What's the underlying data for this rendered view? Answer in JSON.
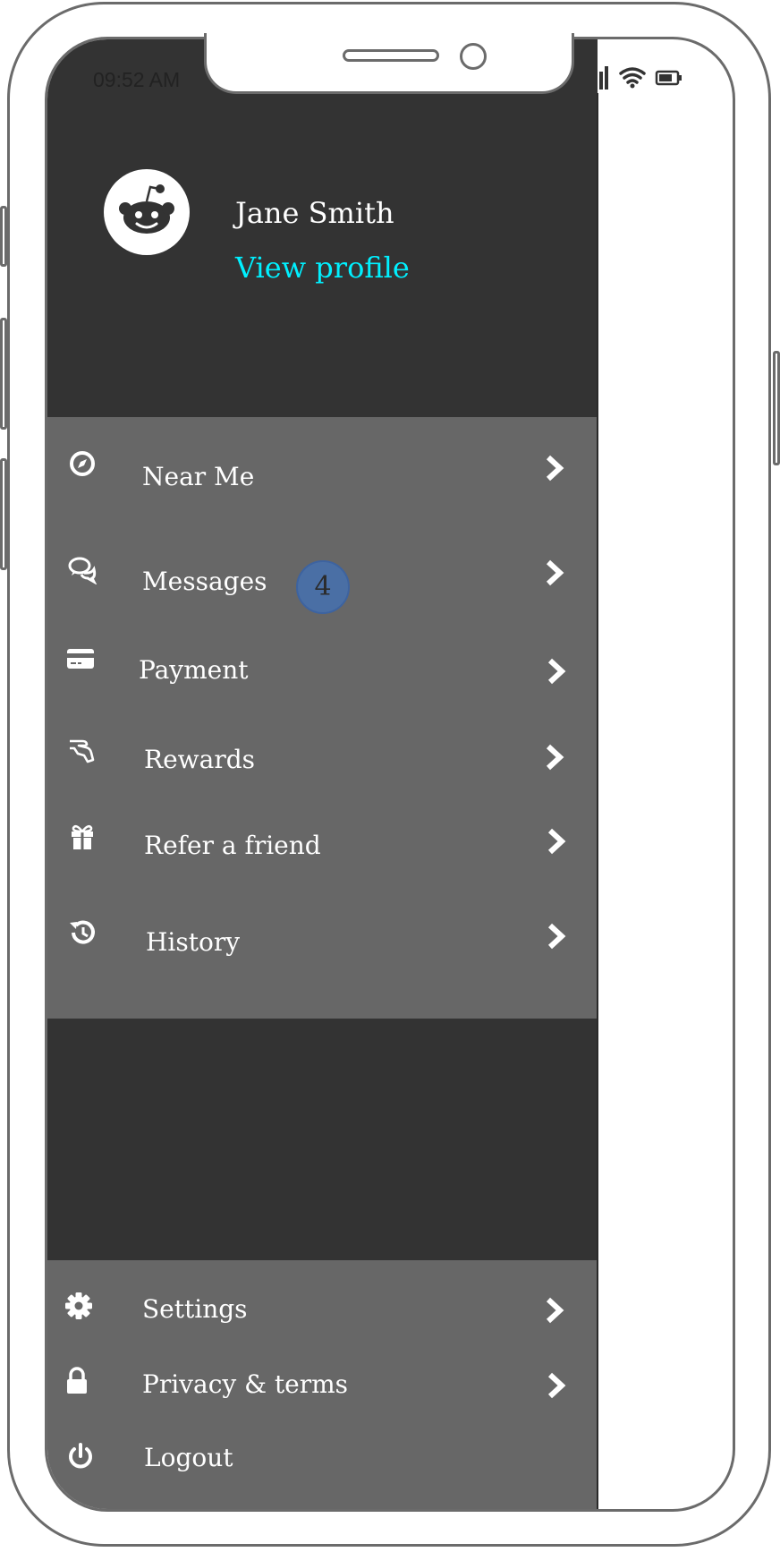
{
  "status_bar": {
    "time": "09:52 AM"
  },
  "profile": {
    "name": "Jane Smith",
    "link": "View profile"
  },
  "menu": {
    "items": [
      {
        "label": "Near Me",
        "icon": "compass-icon"
      },
      {
        "label": "Messages",
        "icon": "chat-bubbles-icon",
        "badge": "4"
      },
      {
        "label": "Payment",
        "icon": "credit-card-icon"
      },
      {
        "label": "Rewards",
        "icon": "hand-reward-icon"
      },
      {
        "label": "Refer a friend",
        "icon": "gift-icon"
      },
      {
        "label": "History",
        "icon": "history-icon"
      }
    ]
  },
  "footer": {
    "items": [
      {
        "label": "Settings",
        "icon": "gear-icon"
      },
      {
        "label": "Privacy & terms",
        "icon": "lock-icon"
      },
      {
        "label": "Logout",
        "icon": "power-icon"
      }
    ]
  },
  "colors": {
    "header_bg": "#333333",
    "menu_bg": "#676767",
    "link": "#00f0ff",
    "badge": "#4a6fa5"
  }
}
